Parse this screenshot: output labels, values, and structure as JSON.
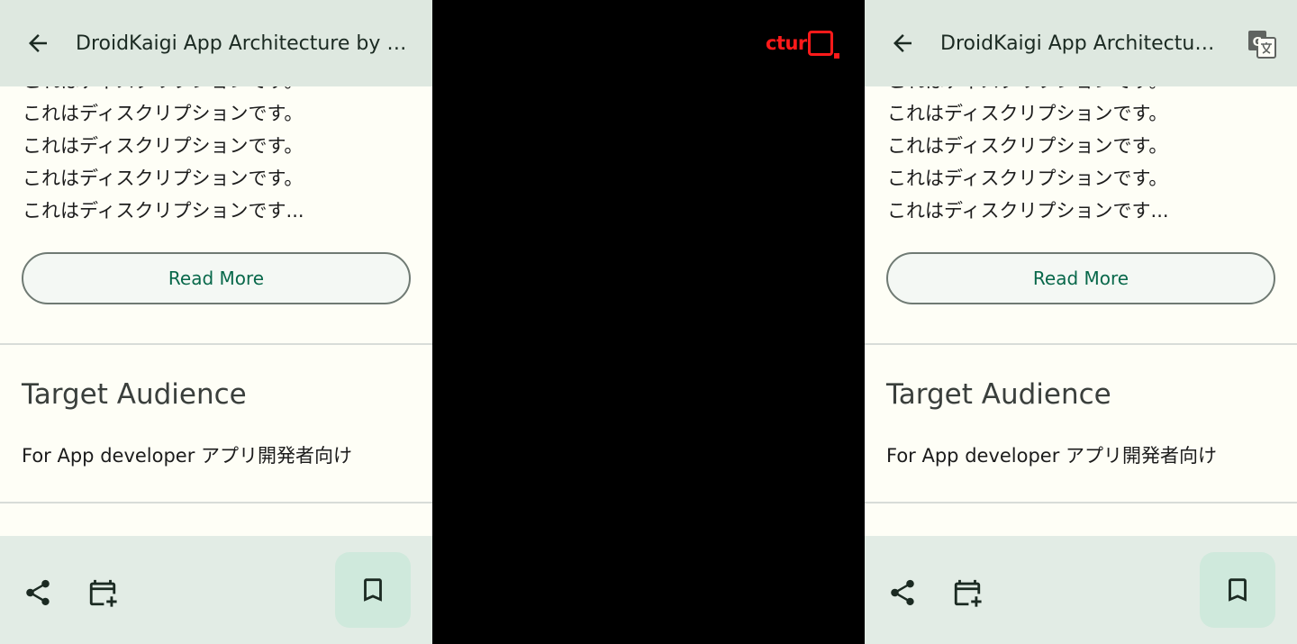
{
  "session": {
    "title": "DroidKaigi App Architecture by arkivanov/Decompose",
    "description_lines": [
      "これはディスクリプションです。",
      "これはディスクリプションです。",
      "これはディスクリプションです。",
      "これはディスクリプションです。",
      "これはディスクリプションです..."
    ],
    "read_more_label": "Read More",
    "target_audience_title": "Target Audience",
    "target_audience_body": "For App developer アプリ開発者向け"
  },
  "overlay_text": "ctur",
  "icons": {
    "back": "arrow-back-icon",
    "translate": "translate-icon",
    "share": "share-icon",
    "calendar_add": "calendar-add-icon",
    "bookmark": "bookmark-icon"
  },
  "colors": {
    "topbar_bg": "#dee8e0",
    "content_bg": "#fefef6",
    "accent": "#08684a",
    "fab_bg": "#cfe9dc",
    "bottombar_bg": "#e2ece5",
    "overlay_red": "#ff1a1a"
  }
}
